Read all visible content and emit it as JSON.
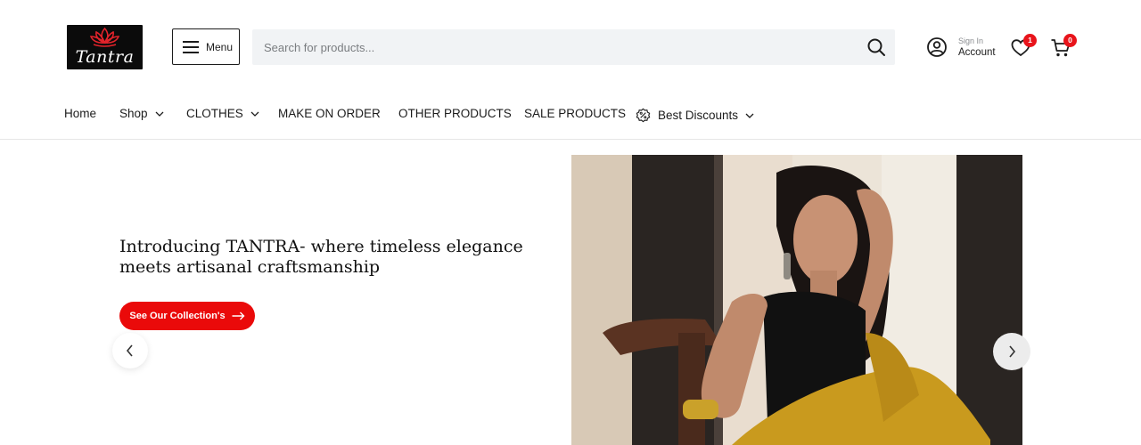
{
  "brand": {
    "name": "Tantra"
  },
  "header": {
    "menu_label": "Menu",
    "search_placeholder": "Search for products...",
    "account_small": "Sign In",
    "account_big": "Account",
    "wishlist_count": "1",
    "cart_count": "0"
  },
  "nav": {
    "items": [
      {
        "label": "Home"
      },
      {
        "label": "Shop"
      },
      {
        "label": "CLOTHES"
      },
      {
        "label": "MAKE ON ORDER"
      },
      {
        "label": "OTHER PRODUCTS"
      },
      {
        "label": "SALE PRODUCTS"
      },
      {
        "label": "Best Discounts"
      }
    ]
  },
  "hero": {
    "title": "Introducing TANTRA- where timeless elegance meets artisanal craftsmanship",
    "cta_label": "See Our Collection's"
  },
  "icons": {
    "logo": "lotus-logo",
    "menu": "hamburger-icon",
    "search": "search-icon",
    "account": "user-circle-icon",
    "wishlist": "heart-icon",
    "cart": "cart-icon",
    "discount": "discount-badge-icon",
    "prev": "chevron-left-icon",
    "next": "chevron-right-icon"
  },
  "colors": {
    "accent": "#ea0a0a",
    "badge": "#e8141b",
    "search_bg": "#f1f3f5",
    "logo_bg": "#0b0b0b",
    "logo_mark": "#e3232b"
  }
}
